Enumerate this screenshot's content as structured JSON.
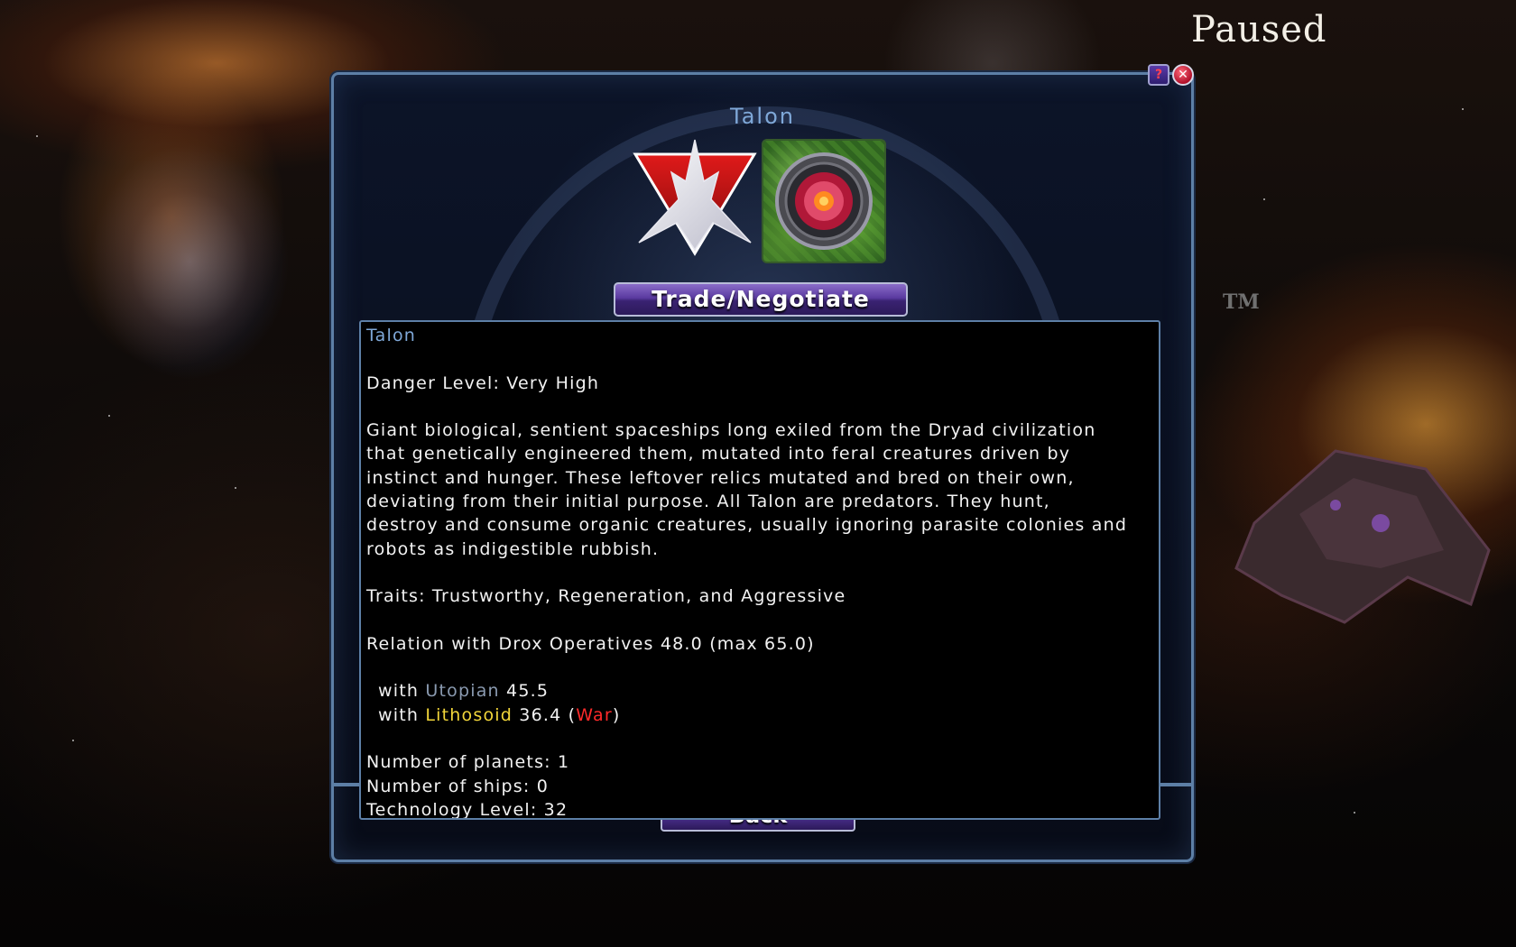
{
  "game": {
    "status_label": "Paused",
    "trademark": "TM"
  },
  "dialog": {
    "title": "Talon",
    "help_icon": "help-icon",
    "close_icon": "close-icon",
    "trade_button_label": "Trade/Negotiate",
    "back_button_label": "Back"
  },
  "info": {
    "race_name": "Talon",
    "danger_level": "Danger Level: Very High",
    "description_lines": [
      "Giant biological, sentient spaceships long exiled from the Dryad civilization",
      "that genetically engineered them, mutated into feral creatures driven by",
      "instinct and hunger. These leftover relics mutated and bred on their own,",
      "deviating from their initial purpose. All Talon are predators. They hunt,",
      "destroy and consume organic creatures, usually ignoring parasite colonies and",
      "robots as indigestible rubbish."
    ],
    "traits": "Traits: Trustworthy, Regeneration, and Aggressive",
    "relation": "Relation with Drox Operatives 48.0 (max 65.0)",
    "relations": [
      {
        "prefix": "with",
        "race": "Utopian",
        "value": "45.5",
        "race_color": "#8a9ab0"
      },
      {
        "prefix": "with",
        "race": "Lithosoid",
        "value": "36.4",
        "open_paren": "(",
        "status": "War",
        "close_paren": ")",
        "race_color": "#f2d63a",
        "status_color": "#ff2a2a"
      }
    ],
    "planets": "Number of planets: 1",
    "ships": "Number of ships: 0",
    "tech_level": "Technology Level: 32"
  },
  "colors": {
    "panel_border": "#5d7fa6",
    "title_blue": "#7fa8d8",
    "button_purple": "#4e3294"
  }
}
